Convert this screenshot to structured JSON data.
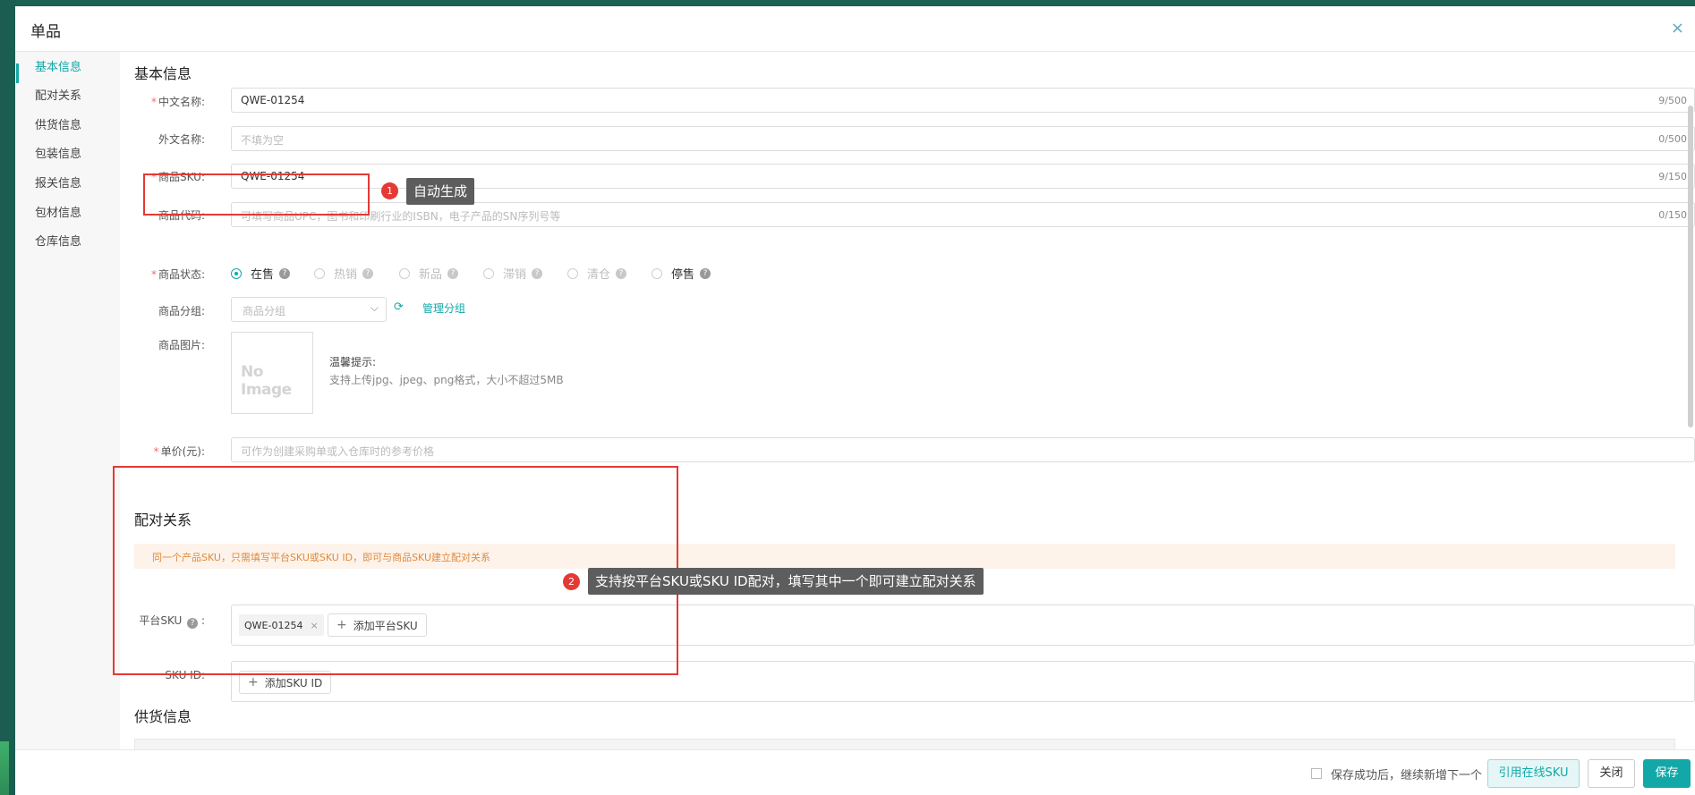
{
  "modal": {
    "title": "单品",
    "close_icon": "×"
  },
  "side_nav": [
    "基本信息",
    "配对关系",
    "供货信息",
    "包装信息",
    "报关信息",
    "包材信息",
    "仓库信息"
  ],
  "basic": {
    "title": "基本信息",
    "cn_name": {
      "label": "中文名称",
      "value": "QWE-01254",
      "count": "9/500"
    },
    "foreign_name": {
      "label": "外文名称",
      "placeholder": "不填为空",
      "count": "0/500"
    },
    "sku": {
      "label": "商品SKU",
      "value": "QWE-01254",
      "count": "9/150"
    },
    "code": {
      "label": "商品代码",
      "placeholder": "可填写商品UPC，图书和印刷行业的ISBN，电子产品的SN序列号等",
      "count": "0/150"
    },
    "status": {
      "label": "商品状态",
      "options": [
        {
          "label": "在售",
          "selected": true,
          "disabled": false
        },
        {
          "label": "热销",
          "selected": false,
          "disabled": true
        },
        {
          "label": "新品",
          "selected": false,
          "disabled": true
        },
        {
          "label": "滞销",
          "selected": false,
          "disabled": true
        },
        {
          "label": "清仓",
          "selected": false,
          "disabled": true
        },
        {
          "label": "停售",
          "selected": false,
          "disabled": false
        }
      ]
    },
    "group": {
      "label": "商品分组",
      "placeholder": "商品分组",
      "manage": "管理分组"
    },
    "image": {
      "label": "商品图片",
      "no_image_text": "No Image",
      "hint_title": "温馨提示:",
      "hint_text": "支持上传jpg、jpeg、png格式，大小不超过5MB"
    },
    "price": {
      "label": "单价(元)",
      "placeholder": "可作为创建采购单或入仓库时的参考价格"
    }
  },
  "pairing": {
    "title": "配对关系",
    "notice": "同一个产品SKU，只需填写平台SKU或SKU ID，即可与商品SKU建立配对关系",
    "platform_sku": {
      "label": "平台SKU",
      "tags": [
        "QWE-01254"
      ],
      "add": "添加平台SKU"
    },
    "sku_id": {
      "label": "SKU ID",
      "add": "添加SKU ID"
    }
  },
  "supply": {
    "title": "供货信息"
  },
  "annotations": [
    {
      "num": "1",
      "text": "自动生成"
    },
    {
      "num": "2",
      "text": "支持按平台SKU或SKU ID配对，填写其中一个即可建立配对关系"
    }
  ],
  "footer": {
    "checkbox_label": "保存成功后，继续新增下一个",
    "cite_button": "引用在线SKU",
    "close_button": "关闭",
    "save_button": "保存"
  },
  "colors": {
    "accent": "#13a8a8",
    "highlight_red": "#e53935",
    "notice_text": "#e08a3c"
  }
}
